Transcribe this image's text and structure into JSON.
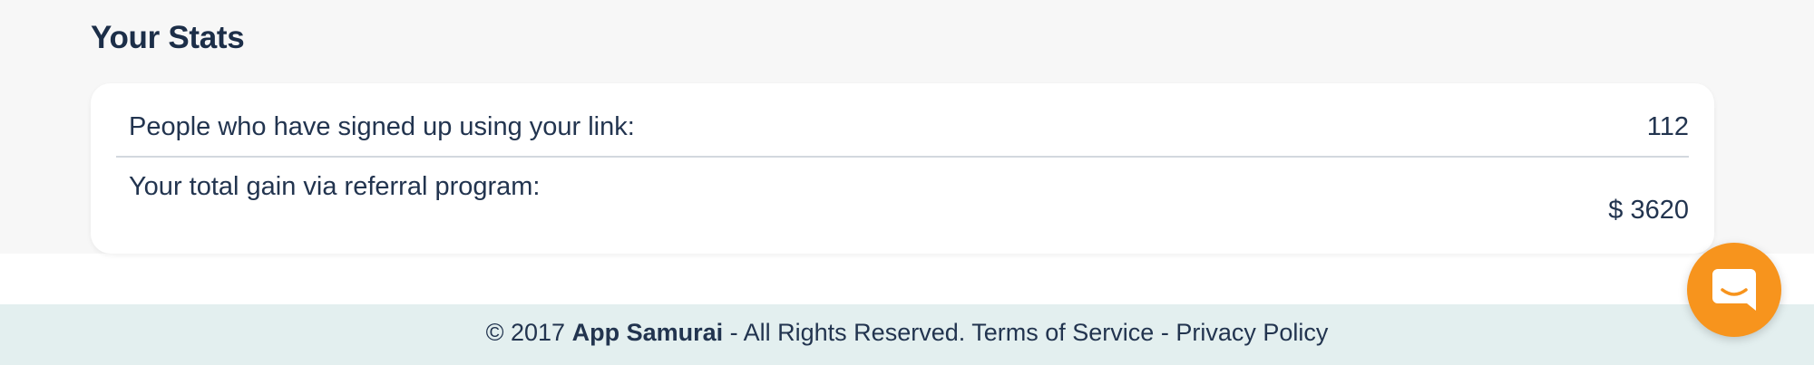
{
  "stats": {
    "title": "Your Stats",
    "rows": [
      {
        "label": "People who have signed up using your link:",
        "value": "112"
      },
      {
        "label": "Your total gain via referral program:",
        "value": "$ 3620"
      }
    ]
  },
  "footer": {
    "copyright": "© 2017",
    "brand": "App Samurai",
    "rights": "- All Rights Reserved.",
    "terms_label": "Terms of Service",
    "separator": "-",
    "privacy_label": "Privacy Policy"
  },
  "chat": {
    "icon": "chat-bubble-icon",
    "color": "#f7941d"
  },
  "colors": {
    "text": "#22344f",
    "page_bg": "#f7f7f7",
    "footer_bg": "#e3efef",
    "accent": "#f7941d"
  }
}
